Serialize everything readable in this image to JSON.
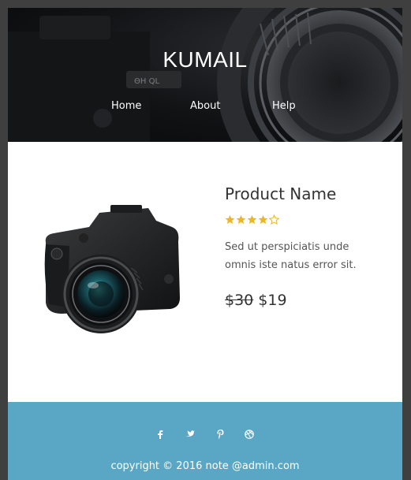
{
  "header": {
    "brand": "KUMAIL",
    "nav": [
      "Home",
      "About",
      "Help"
    ]
  },
  "product": {
    "name": "Product Name",
    "rating": 4,
    "rating_max": 5,
    "description": "Sed ut perspiciatis unde omnis iste natus error sit.",
    "old_price": "$30",
    "price": "$19"
  },
  "footer": {
    "social": [
      "facebook-icon",
      "twitter-icon",
      "pinterest-icon",
      "dribbble-icon"
    ],
    "copyright": "copyright © 2016 note @admin.com"
  },
  "colors": {
    "footer_bg": "#59a7c4",
    "star": "#e8b923",
    "page_bg": "#3f3f3f"
  }
}
